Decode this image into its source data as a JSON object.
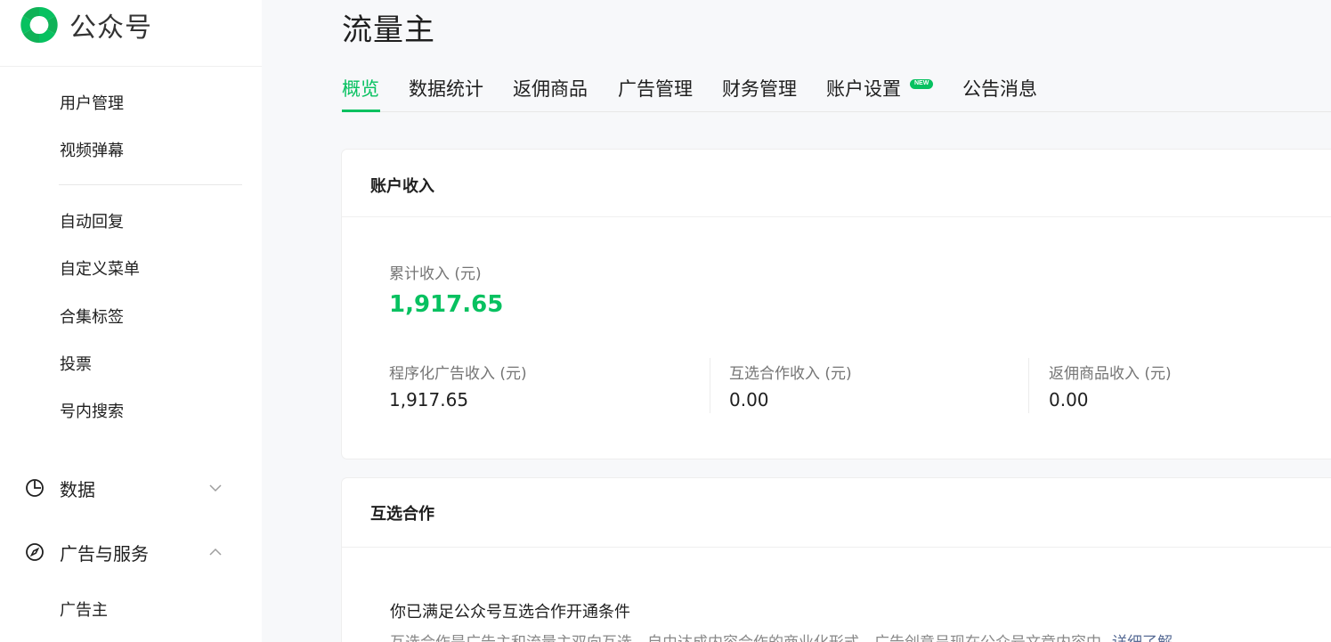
{
  "app": {
    "name": "公众号"
  },
  "sidebar": {
    "items_top": [
      "用户管理",
      "视频弹幕"
    ],
    "items_mid": [
      "自动回复",
      "自定义菜单",
      "合集标签",
      "投票",
      "号内搜索"
    ],
    "groups": [
      {
        "label": "数据",
        "icon": "clock-chart-icon",
        "expanded": false
      },
      {
        "label": "广告与服务",
        "icon": "compass-icon",
        "expanded": true
      }
    ],
    "items_bottom": [
      "广告主"
    ]
  },
  "page": {
    "title": "流量主"
  },
  "tabs": [
    {
      "label": "概览",
      "active": true
    },
    {
      "label": "数据统计"
    },
    {
      "label": "返佣商品"
    },
    {
      "label": "广告管理"
    },
    {
      "label": "财务管理"
    },
    {
      "label": "账户设置",
      "badge": "NEW"
    },
    {
      "label": "公告消息"
    }
  ],
  "income": {
    "title": "账户收入",
    "total_label": "累计收入 (元)",
    "total_value": "1,917.65",
    "breakdown": [
      {
        "label": "程序化广告收入 (元)",
        "value": "1,917.65"
      },
      {
        "label": "互选合作收入 (元)",
        "value": "0.00"
      },
      {
        "label": "返佣商品收入 (元)",
        "value": "0.00"
      }
    ]
  },
  "coop": {
    "title": "互选合作",
    "status": "你已满足公众号互选合作开通条件",
    "desc": "互选合作是广告主和流量主双向互选，自由达成内容合作的商业化形式，广告创意呈现在公众号文章内容中",
    "link": "详细了解"
  },
  "colors": {
    "accent": "#07c160",
    "link": "#576b95"
  }
}
